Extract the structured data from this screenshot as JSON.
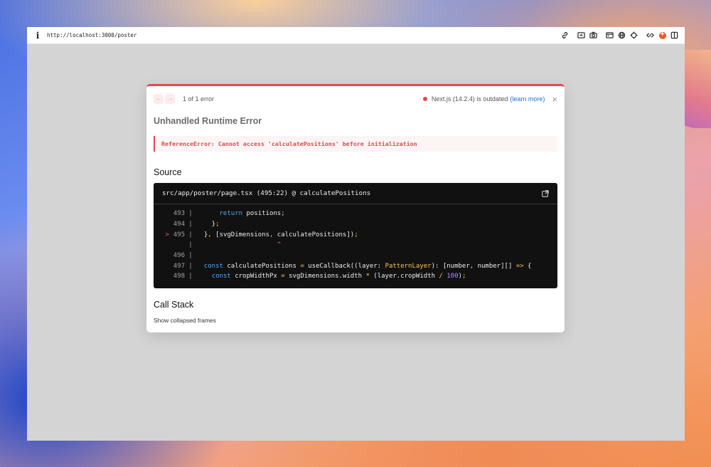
{
  "browser": {
    "info_icon": "i",
    "url": "http://localhost:3000/poster",
    "toolbar_icons": [
      "link-icon",
      "screenshot-region-icon",
      "camera-icon",
      "window-icon",
      "globe-icon",
      "crosshair-icon",
      "code-icon",
      "extension-badge-icon",
      "split-view-icon"
    ]
  },
  "overlay": {
    "nav": {
      "prev": "←",
      "next": "→"
    },
    "error_count": "1 of 1 error",
    "version_text": "Next.js (14.2.4) is outdated",
    "learn_more": "(learn more)",
    "close": "×",
    "title": "Unhandled Runtime Error",
    "error_message": "ReferenceError: Cannot access 'calculatePositions' before initialization",
    "source_heading": "Source",
    "file_location": "src/app/poster/page.tsx (495:22) @ calculatePositions",
    "code_lines": [
      {
        "marker": "",
        "num": "493",
        "bar": "|",
        "code": "      return positions;"
      },
      {
        "marker": "",
        "num": "494",
        "bar": "|",
        "code": "    };"
      },
      {
        "marker": ">",
        "num": "495",
        "bar": "|",
        "code": "  }, [svgDimensions, calculatePositions]);"
      },
      {
        "marker": "",
        "num": "",
        "bar": "|",
        "code": "                     ^"
      },
      {
        "marker": "",
        "num": "496",
        "bar": "|",
        "code": ""
      },
      {
        "marker": "",
        "num": "497",
        "bar": "|",
        "code": "  const calculatePositions = useCallback((layer: PatternLayer): [number, number][] => {"
      },
      {
        "marker": "",
        "num": "498",
        "bar": "|",
        "code": "    const cropWidthPx = svgDimensions.width * (layer.cropWidth / 100);"
      }
    ],
    "callstack_heading": "Call Stack",
    "show_collapsed": "Show collapsed frames"
  },
  "colors": {
    "error_accent": "#e5484d",
    "link": "#1d6fd8",
    "code_bg": "#111111",
    "keyword": "#4fa8ff",
    "operator": "#ffc44f",
    "number": "#b58bff"
  }
}
